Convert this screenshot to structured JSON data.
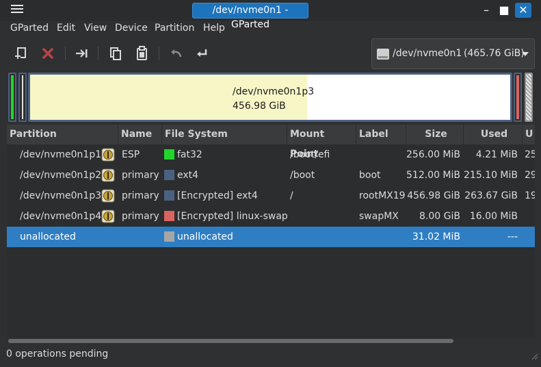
{
  "window": {
    "title": "/dev/nvme0n1 - GParted"
  },
  "menu": [
    "GParted",
    "Edit",
    "View",
    "Device",
    "Partition",
    "Help"
  ],
  "device_selector": {
    "name": "/dev/nvme0n1",
    "size": "(465.76 GiB)"
  },
  "disk_map": {
    "label_name": "/dev/nvme0n1p3",
    "label_size": "456.98 GiB",
    "p3_used_fraction": 0.577
  },
  "table": {
    "headers": [
      "Partition",
      "Name",
      "File System",
      "Mount Point",
      "Label",
      "Size",
      "Used",
      "U"
    ],
    "rows": [
      {
        "partition": "/dev/nvme0n1p1",
        "name": "ESP",
        "fs": "fat32",
        "mount": "/boot/efi",
        "label": "",
        "size": "256.00 MiB",
        "used": "4.21 MiB",
        "unused": "25",
        "color": "#21d62a",
        "lock": true,
        "selected": false
      },
      {
        "partition": "/dev/nvme0n1p2",
        "name": "primary",
        "fs": "ext4",
        "mount": "/boot",
        "label": "boot",
        "size": "512.00 MiB",
        "used": "215.10 MiB",
        "unused": "29",
        "color": "#4b6180",
        "lock": true,
        "selected": false
      },
      {
        "partition": "/dev/nvme0n1p3",
        "name": "primary",
        "fs": "[Encrypted] ext4",
        "mount": "/",
        "label": "rootMX19",
        "size": "456.98 GiB",
        "used": "263.67 GiB",
        "unused": "19",
        "color": "#4b6180",
        "lock": true,
        "selected": false
      },
      {
        "partition": "/dev/nvme0n1p4",
        "name": "primary",
        "fs": "[Encrypted] linux-swap",
        "mount": "",
        "label": "swapMX",
        "size": "8.00 GiB",
        "used": "16.00 MiB",
        "unused": "",
        "color": "#d9645f",
        "lock": true,
        "selected": false
      },
      {
        "partition": "unallocated",
        "name": "",
        "fs": "unallocated",
        "mount": "",
        "label": "",
        "size": "31.02 MiB",
        "used": "---",
        "unused": "",
        "color": "#a6a6a6",
        "lock": false,
        "selected": true
      }
    ]
  },
  "status": {
    "text": "0 operations pending"
  }
}
